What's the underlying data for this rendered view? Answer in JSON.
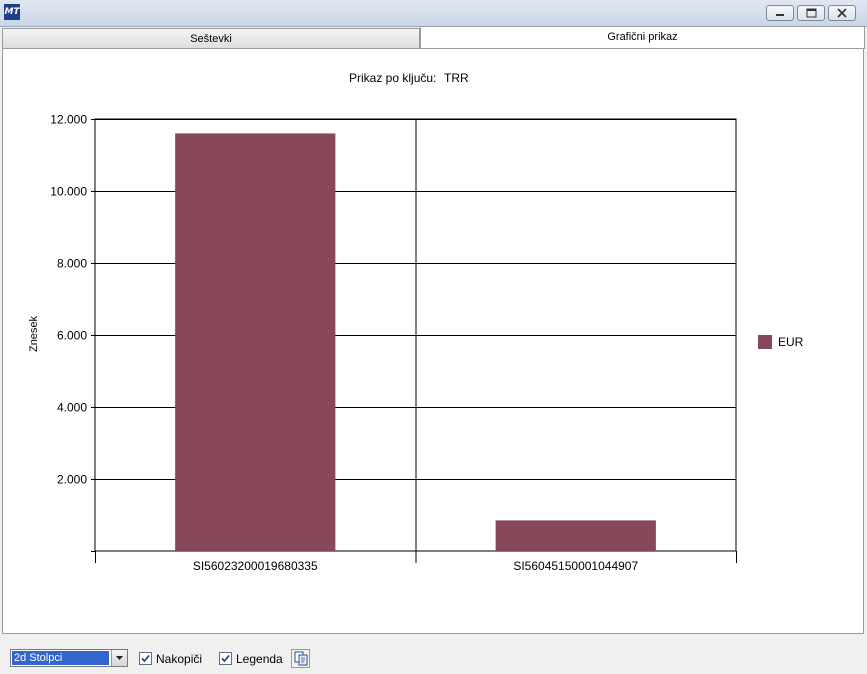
{
  "window": {
    "title": ""
  },
  "tabs": [
    {
      "label": "Seštevki",
      "active": false
    },
    {
      "label": "Grafični prikaz",
      "active": true
    }
  ],
  "chart_title": {
    "prefix": "Prikaz po ključu:",
    "key": "TRR"
  },
  "chart_data": {
    "type": "bar",
    "categories": [
      "SI56023200019680335",
      "SI56045150001044907"
    ],
    "series": [
      {
        "name": "EUR",
        "values": [
          11600,
          850
        ],
        "color": "#87485a"
      }
    ],
    "ylabel": "Znesek",
    "xlabel": "",
    "ylim": [
      0,
      12000
    ],
    "yticks": [
      2000,
      4000,
      6000,
      8000,
      10000,
      12000
    ],
    "ytick_labels": [
      "2.000",
      "4.000",
      "6.000",
      "8.000",
      "10.000",
      "12.000"
    ],
    "grid": true,
    "legend_position": "right"
  },
  "toolbar": {
    "chart_type_value": "2d Stolpci",
    "stack_label": "Nakopiči",
    "stack_checked": true,
    "legend_label": "Legenda",
    "legend_checked": true
  },
  "icons": {
    "copy": "copy-icon",
    "minimize": "minimize-icon",
    "restore": "restore-icon",
    "close": "close-icon"
  }
}
